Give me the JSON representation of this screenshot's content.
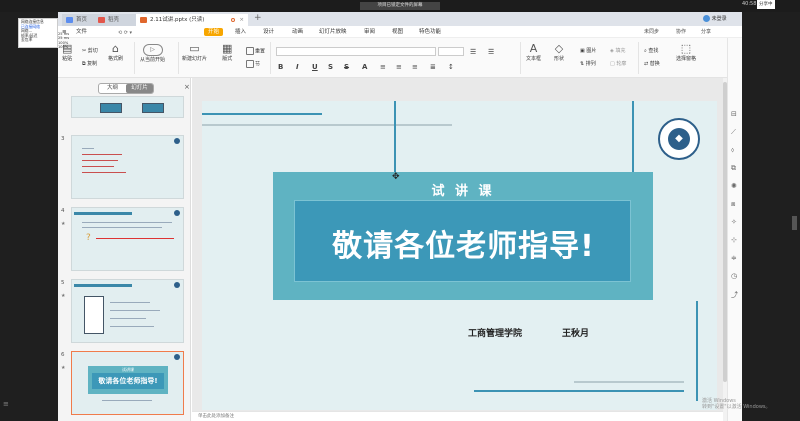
{
  "remote": {
    "window_title": "项目已锁定文件的屏幕",
    "clock": "40:58",
    "badge": "分享中"
  },
  "network_popup": {
    "title": "网络连接信息",
    "highlight": "已连接网络",
    "lines": [
      "网络...",
      "帧率/延迟",
      "丢包率"
    ]
  },
  "speeds": [
    "25 ms",
    "25 ms",
    "100%",
    "100%"
  ],
  "tabs": [
    {
      "label": "首页"
    },
    {
      "label": "稻壳"
    },
    {
      "label": "2.11试讲.pptx (只读)"
    }
  ],
  "tabbar_right": "未登录",
  "menu": {
    "items": [
      "文件",
      "开始",
      "插入",
      "设计",
      "动画",
      "幻灯片放映",
      "审阅",
      "视图",
      "特色功能"
    ],
    "active": "开始",
    "right": [
      "未同步",
      "协作",
      "分享"
    ]
  },
  "ribbon": {
    "paste": "粘贴",
    "cut": "剪切",
    "copy": "复制",
    "format_painter": "格式刷",
    "play_from_current": "从当前开始",
    "new_slide": "新建幻灯片",
    "layout": "版式",
    "reset": "重置",
    "section": "节",
    "textbox": "文本框",
    "shape": "形状",
    "picture": "图片",
    "arrange": "排列",
    "fill": "填充",
    "outline": "轮廓",
    "find": "查找",
    "replace": "替换",
    "select_pane": "选择窗格"
  },
  "panel": {
    "outline_tab": "大纲",
    "slides_tab": "幻灯片",
    "close": "×",
    "add": "+"
  },
  "thumbnails": [
    {
      "number": "3"
    },
    {
      "number": "4"
    },
    {
      "number": "5"
    },
    {
      "number": "6",
      "lecture": "试讲课",
      "title": "敬请各位老师指导!"
    }
  ],
  "slide": {
    "lecture": "试 讲 课",
    "title": "敬请各位老师指导!",
    "school": "工商管理学院",
    "presenter": "王秋月"
  },
  "status": {
    "note_placeholder": "单击此处添加备注"
  },
  "watermark": [
    "激活 Windows",
    "转到\"设置\"以激活 Windows。"
  ]
}
